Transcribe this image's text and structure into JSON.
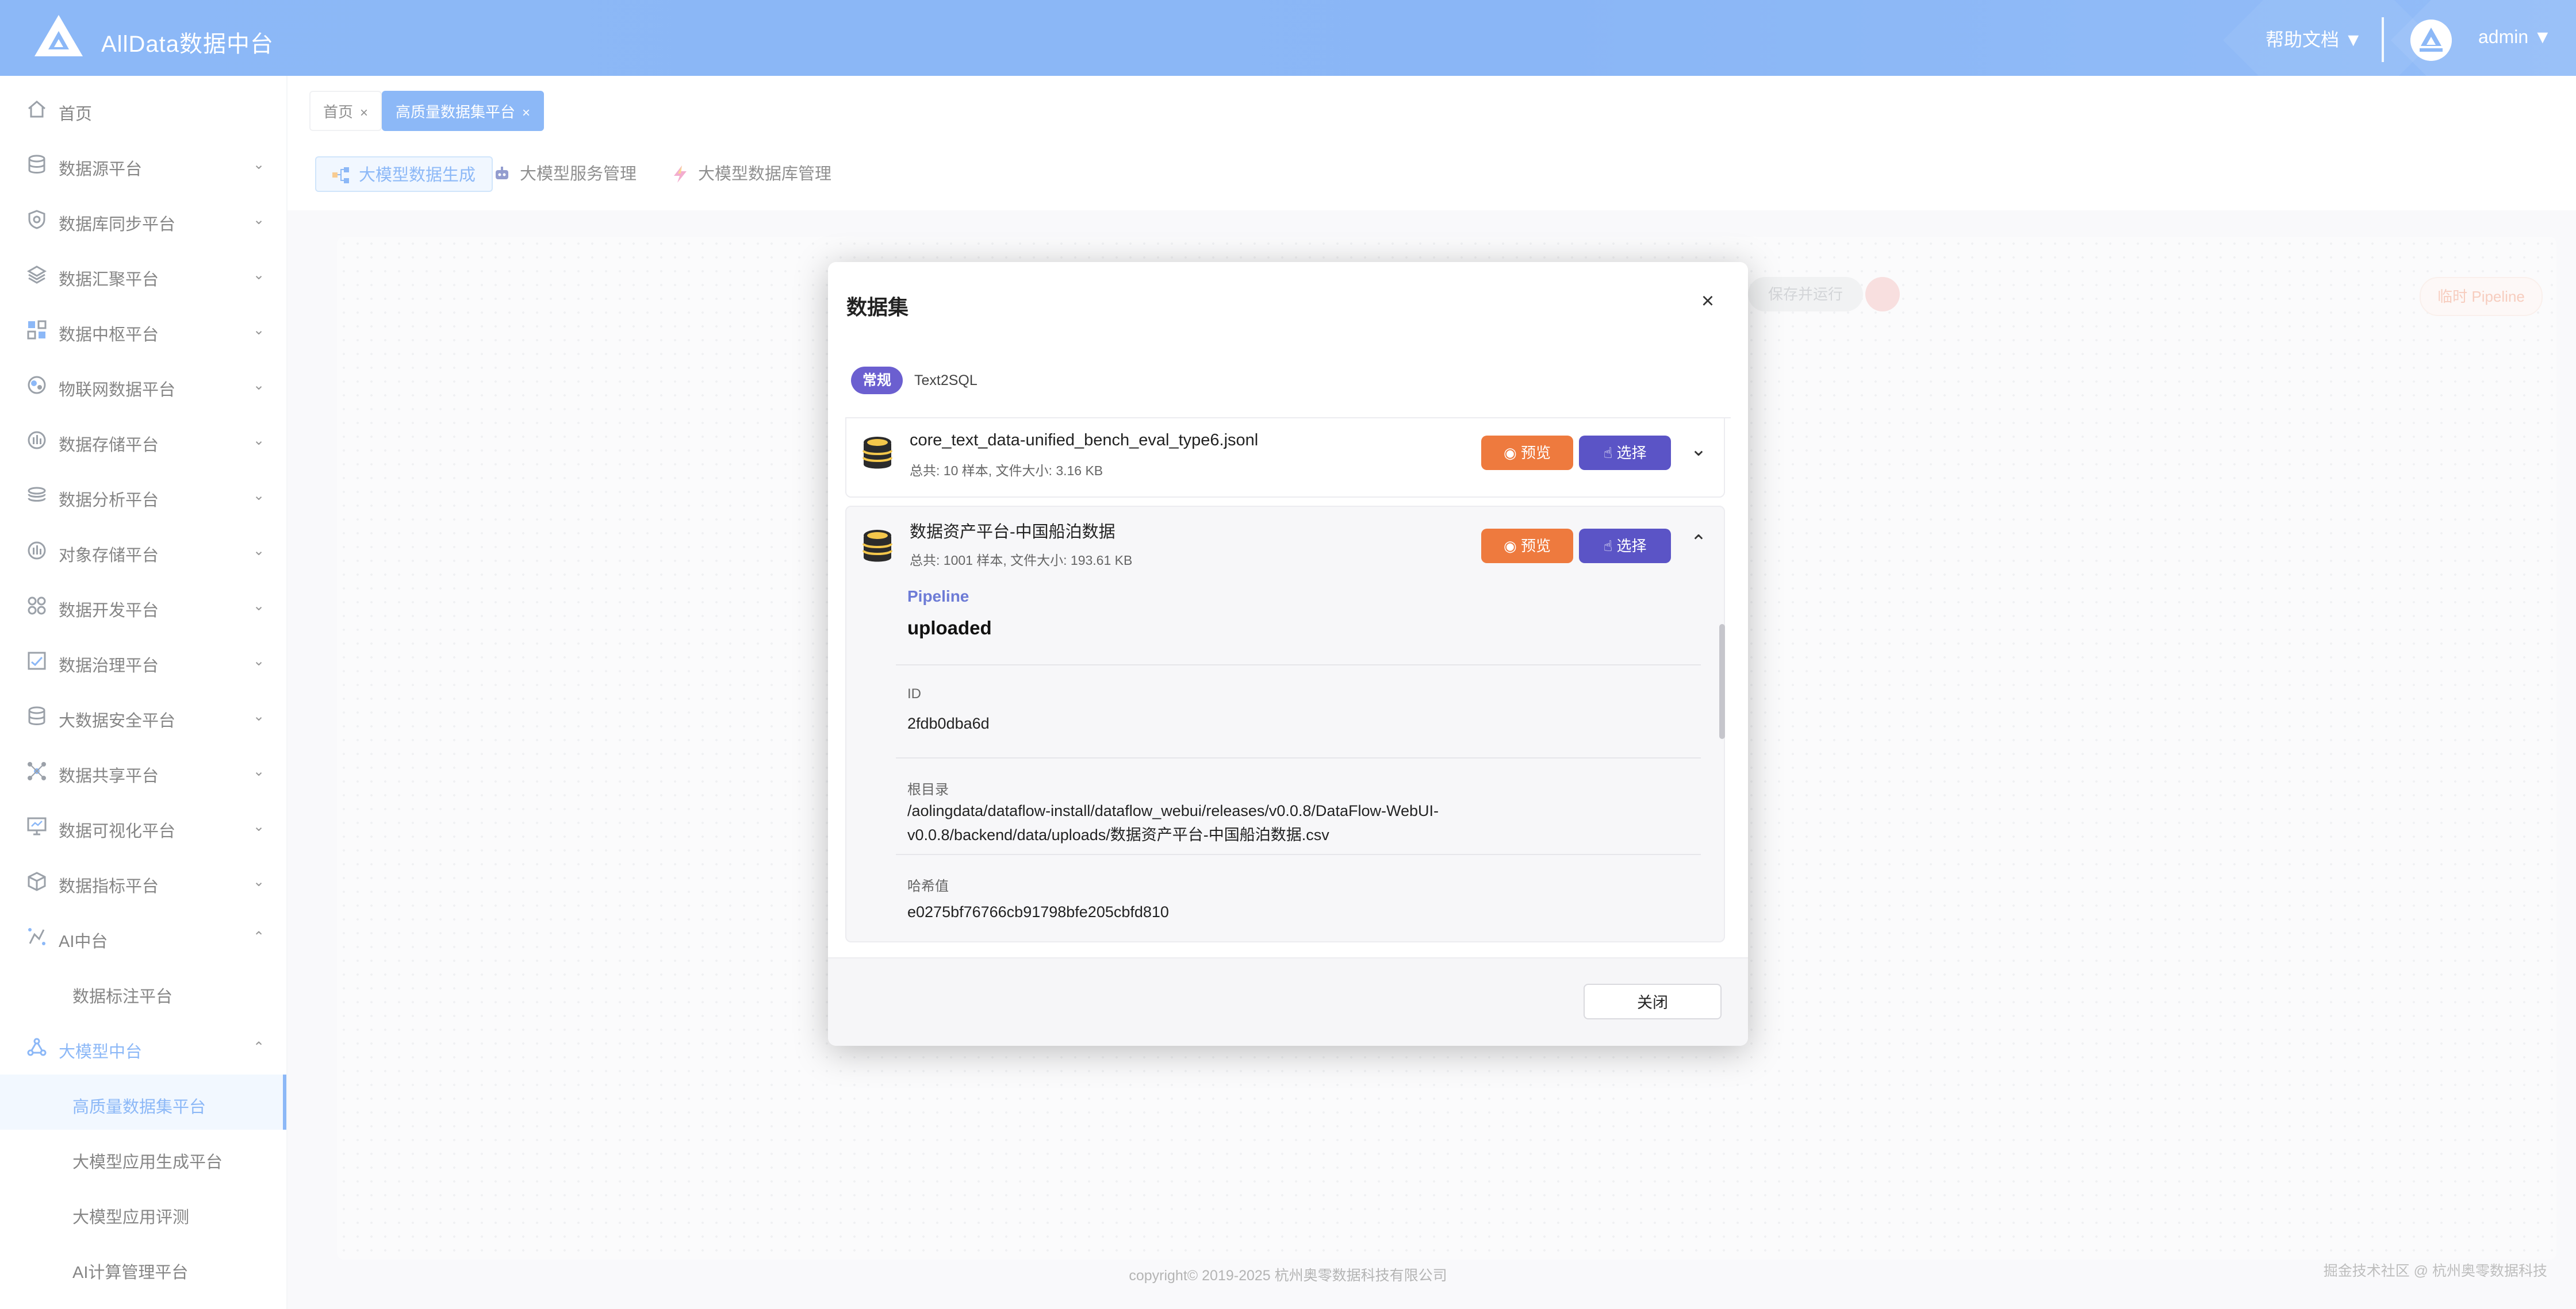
{
  "header": {
    "app_title": "AllData数据中台",
    "help_docs": "帮助文档 ▼",
    "admin": "admin ▼",
    "brand_color": "#2f7ff0"
  },
  "sidebar": {
    "items": [
      {
        "label": "首页",
        "icon": "home-icon"
      },
      {
        "label": "数据源平台",
        "icon": "database-icon"
      },
      {
        "label": "数据库同步平台",
        "icon": "sync-icon"
      },
      {
        "label": "数据汇聚平台",
        "icon": "layers-icon"
      },
      {
        "label": "数据中枢平台",
        "icon": "grid-icon"
      },
      {
        "label": "物联网数据平台",
        "icon": "iot-icon"
      },
      {
        "label": "数据存储平台",
        "icon": "storage-icon"
      },
      {
        "label": "数据分析平台",
        "icon": "analysis-icon"
      },
      {
        "label": "对象存储平台",
        "icon": "object-storage-icon"
      },
      {
        "label": "数据开发平台",
        "icon": "develop-icon"
      },
      {
        "label": "数据治理平台",
        "icon": "governance-icon"
      },
      {
        "label": "大数据安全平台",
        "icon": "security-icon"
      },
      {
        "label": "数据共享平台",
        "icon": "share-icon"
      },
      {
        "label": "数据可视化平台",
        "icon": "monitor-icon"
      },
      {
        "label": "数据指标平台",
        "icon": "cube-icon"
      },
      {
        "label": "AI中台",
        "icon": "ai-icon"
      },
      {
        "label": "数据标注平台"
      },
      {
        "label": "大模型中台",
        "icon": "model-icon"
      },
      {
        "label": "高质量数据集平台"
      },
      {
        "label": "大模型应用生成平台"
      },
      {
        "label": "大模型应用评测"
      },
      {
        "label": "AI计算管理平台"
      }
    ]
  },
  "page_tabs": [
    {
      "label": "首页"
    },
    {
      "label": "高质量数据集平台"
    }
  ],
  "sub_tabs": [
    {
      "label": "大模型数据生成"
    },
    {
      "label": "大模型服务管理"
    },
    {
      "label": "大模型数据库管理"
    }
  ],
  "background": {
    "save_run": "保存并运行",
    "temp_pipeline": "临时 Pipeline"
  },
  "footer": {
    "copyright": "copyright© 2019-2025 杭州奥零数据科技有限公司",
    "watermark": "掘金技术社区 @ 杭州奥零数据科技"
  },
  "modal": {
    "title": "数据集",
    "segments": [
      "常规",
      "Text2SQL"
    ],
    "datasets": [
      {
        "name": "core_text_data-unified_bench_eval_type6.jsonl",
        "meta": "总共: 10 样本, 文件大小: 3.16 KB",
        "preview": "预览",
        "select": "选择"
      },
      {
        "name": "数据资产平台-中国船泊数据",
        "meta": "总共: 1001 样本, 文件大小: 193.61 KB",
        "preview": "预览",
        "select": "选择",
        "pipeline_label": "Pipeline",
        "pipeline_value": "uploaded",
        "id_label": "ID",
        "id_value": "2fdb0dba6d",
        "root_label": "根目录",
        "root_value": "/aolingdata/dataflow-install/dataflow_webui/releases/v0.0.8/DataFlow-WebUI-v0.0.8/backend/data/uploads/数据资产平台-中国船泊数据.csv",
        "hash_label": "哈希值",
        "hash_value": "e0275bf76766cb91798bfe205cbfd810"
      }
    ],
    "close_label": "关闭",
    "colors": {
      "preview": "#ee7a3e",
      "select": "#5b54c6",
      "segment_active": "#6b5fd0"
    }
  }
}
